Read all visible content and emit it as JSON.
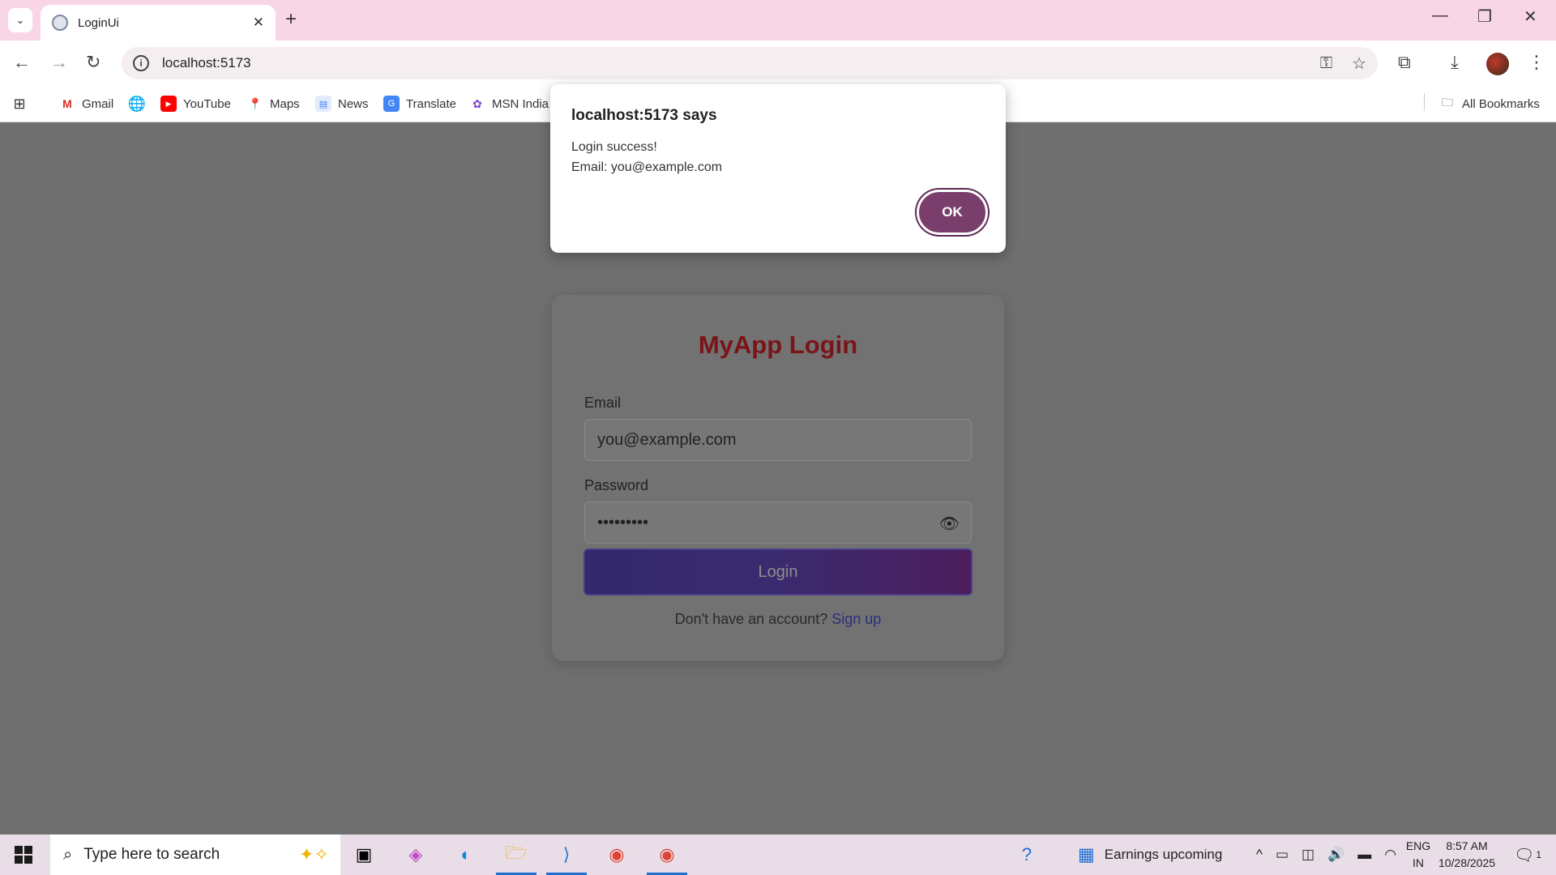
{
  "browser": {
    "tab_title": "LoginUi",
    "url": "localhost:5173",
    "bookmarks": [
      "Gmail",
      "YouTube",
      "Maps",
      "News",
      "Translate",
      "MSN India"
    ],
    "all_bookmarks": "All Bookmarks"
  },
  "page": {
    "title": "MyApp Login",
    "email_label": "Email",
    "email_value": "you@example.com",
    "password_label": "Password",
    "password_value": "•••••••••",
    "login_button": "Login",
    "signup_prompt": "Don't have an account?",
    "signup_link": "Sign up"
  },
  "dialog": {
    "title": "localhost:5173 says",
    "line1": "Login success!",
    "line2": "Email: you@example.com",
    "ok": "OK"
  },
  "taskbar": {
    "search_placeholder": "Type here to search",
    "widget": "Earnings upcoming",
    "lang_top": "ENG",
    "lang_bottom": "IN",
    "time": "8:57 AM",
    "date": "10/28/2025",
    "notification_count": "1"
  },
  "colors": {
    "accent": "#7a3e6d",
    "title": "#7a1418",
    "link": "#2a2f7a"
  }
}
